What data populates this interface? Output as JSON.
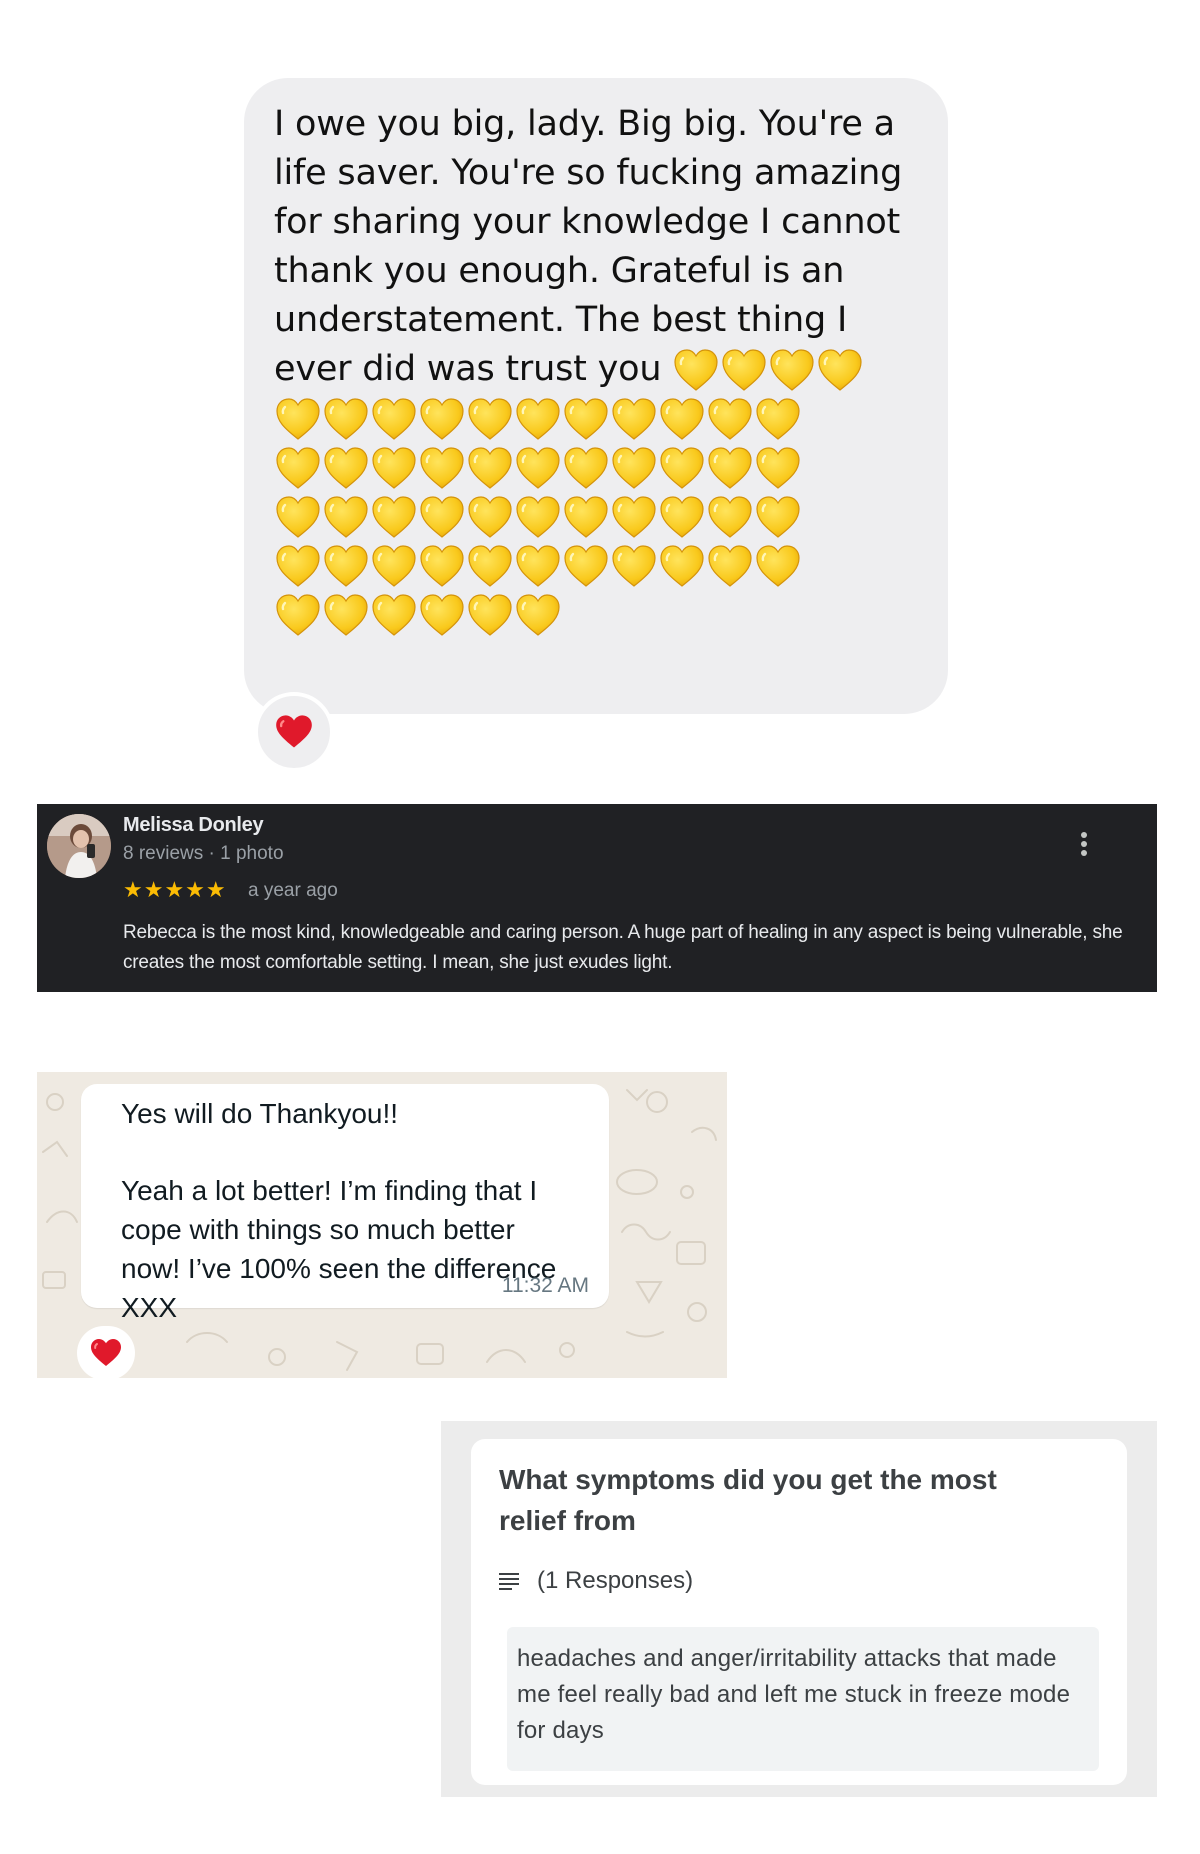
{
  "imessage": {
    "message": "I owe you big, lady. Big big. You're a life saver. You're so fucking amazing for sharing your knowledge I cannot thank you enough. Grateful is an understatement. The best thing I ever did was trust you",
    "yellow_heart_count": 54,
    "reaction": "red-heart-icon",
    "bubble_color": "#eeeef0"
  },
  "review": {
    "reviewer_name": "Melissa Donley",
    "reviewer_meta": "8 reviews · 1 photo",
    "stars": "★★★★★",
    "rating": 5,
    "time": "a year ago",
    "text": "Rebecca is the most kind, knowledgeable and caring person. A huge part of healing in any aspect is being vulnerable, she creates the most comfortable setting. I mean, she just exudes light.",
    "background": "#202124",
    "star_color": "#fbbc04"
  },
  "whatsapp": {
    "line1": "Yes will do Thankyou!!",
    "line2": "Yeah a lot better! I’m finding that I",
    "line3": "cope with things so much better",
    "line4": "now! I’ve 100% seen the difference",
    "line5": "XXX",
    "time": "11:32 AM",
    "reaction": "red-heart-icon"
  },
  "form": {
    "question": "What symptoms did you get the most relief from",
    "responses": "(1 Responses)",
    "answer": "headaches and anger/irritability attacks that made me feel really bad and left me stuck in freeze mode for days"
  }
}
